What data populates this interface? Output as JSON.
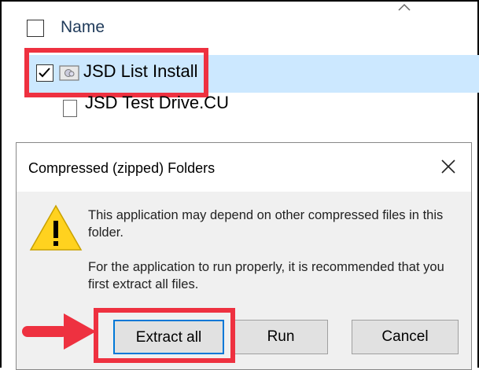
{
  "explorer": {
    "column_name": "Name",
    "files": [
      {
        "name": "JSD List Install",
        "checked": true,
        "selected": true
      },
      {
        "name": "JSD Test Drive.CU",
        "checked": false,
        "selected": false
      }
    ]
  },
  "dialog": {
    "title": "Compressed (zipped) Folders",
    "message_1": "This application may depend on other compressed files in this folder.",
    "message_2": "For the application to run properly, it is recommended that you first extract all files.",
    "buttons": {
      "extract_all": "Extract all",
      "run": "Run",
      "cancel": "Cancel"
    }
  },
  "colors": {
    "highlight": "#ee3140",
    "selection": "#cce8ff",
    "accent": "#0078d7",
    "warning": "#ffd21f"
  },
  "icons": [
    "checkbox-icon",
    "zip-folder-icon",
    "close-icon",
    "warning-icon",
    "arrow-icon",
    "sort-caret-icon"
  ]
}
